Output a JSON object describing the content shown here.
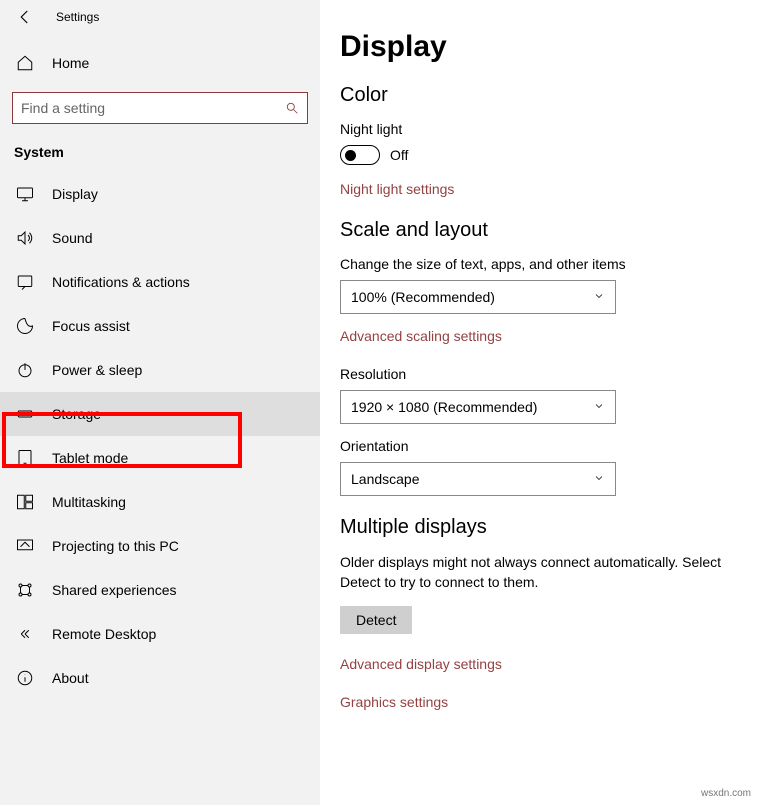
{
  "header": {
    "title": "Settings",
    "home_label": "Home"
  },
  "search": {
    "placeholder": "Find a setting"
  },
  "sidebar": {
    "section_title": "System",
    "items": [
      {
        "label": "Display"
      },
      {
        "label": "Sound"
      },
      {
        "label": "Notifications & actions"
      },
      {
        "label": "Focus assist"
      },
      {
        "label": "Power & sleep"
      },
      {
        "label": "Storage"
      },
      {
        "label": "Tablet mode"
      },
      {
        "label": "Multitasking"
      },
      {
        "label": "Projecting to this PC"
      },
      {
        "label": "Shared experiences"
      },
      {
        "label": "Remote Desktop"
      },
      {
        "label": "About"
      }
    ]
  },
  "main": {
    "page_title": "Display",
    "color_heading": "Color",
    "night_light_label": "Night light",
    "night_light_state": "Off",
    "night_light_link": "Night light settings",
    "scale_heading": "Scale and layout",
    "scale_label": "Change the size of text, apps, and other items",
    "scale_value": "100% (Recommended)",
    "scale_link": "Advanced scaling settings",
    "resolution_label": "Resolution",
    "resolution_value": "1920 × 1080 (Recommended)",
    "orientation_label": "Orientation",
    "orientation_value": "Landscape",
    "multi_heading": "Multiple displays",
    "multi_text": "Older displays might not always connect automatically. Select Detect to try to connect to them.",
    "detect_label": "Detect",
    "adv_display_link": "Advanced display settings",
    "graphics_link": "Graphics settings"
  },
  "watermark": "wsxdn.com"
}
